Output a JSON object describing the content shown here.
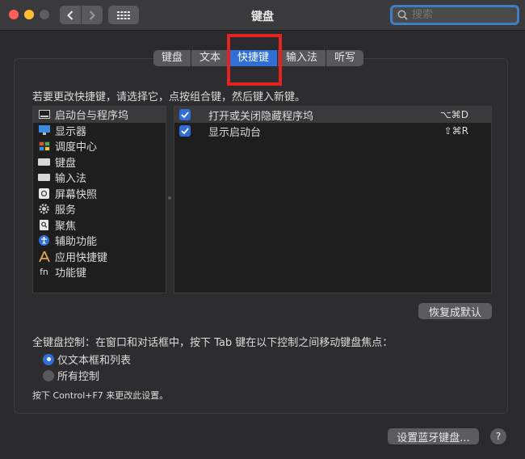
{
  "window": {
    "title": "键盘"
  },
  "search": {
    "placeholder": "搜索"
  },
  "tabs": [
    {
      "label": "键盘",
      "active": false
    },
    {
      "label": "文本",
      "active": false
    },
    {
      "label": "快捷键",
      "active": true
    },
    {
      "label": "输入法",
      "active": false
    },
    {
      "label": "听写",
      "active": false
    }
  ],
  "instruction": "若要更改快捷键，请选择它，点按组合键，然后键入新键。",
  "categories": [
    {
      "label": "启动台与程序坞",
      "icon": "dock-icon",
      "selected": true
    },
    {
      "label": "显示器",
      "icon": "display-icon",
      "selected": false
    },
    {
      "label": "调度中心",
      "icon": "mission-control-icon",
      "selected": false
    },
    {
      "label": "键盘",
      "icon": "keyboard-icon",
      "selected": false
    },
    {
      "label": "输入法",
      "icon": "input-source-icon",
      "selected": false
    },
    {
      "label": "屏幕快照",
      "icon": "screenshot-icon",
      "selected": false
    },
    {
      "label": "服务",
      "icon": "gear-icon",
      "selected": false
    },
    {
      "label": "聚焦",
      "icon": "spotlight-icon",
      "selected": false
    },
    {
      "label": "辅助功能",
      "icon": "accessibility-icon",
      "selected": false
    },
    {
      "label": "应用快捷键",
      "icon": "app-shortcuts-icon",
      "selected": false
    },
    {
      "label": "功能键",
      "icon": "fn-key-icon",
      "selected": false
    }
  ],
  "shortcuts": [
    {
      "label": "打开或关闭隐藏程序坞",
      "keys": "⌥⌘D",
      "checked": true,
      "selected": true
    },
    {
      "label": "显示启动台",
      "keys": "⇧⌘R",
      "checked": true,
      "selected": false
    }
  ],
  "buttons": {
    "restore": "恢复成默认",
    "bluetooth": "设置蓝牙键盘...",
    "help": "?"
  },
  "keyboard_control": {
    "label": "全键盘控制：在窗口和对话框中，按下 Tab 键在以下控制之间移动键盘焦点：",
    "options": [
      {
        "label": "仅文本框和列表",
        "selected": true
      },
      {
        "label": "所有控制",
        "selected": false
      }
    ],
    "note": "按下 Control+F7 来更改此设置。"
  },
  "colors": {
    "accent": "#2f6fd6",
    "highlight_box": "#e52222",
    "background": "#2a2a2c"
  }
}
